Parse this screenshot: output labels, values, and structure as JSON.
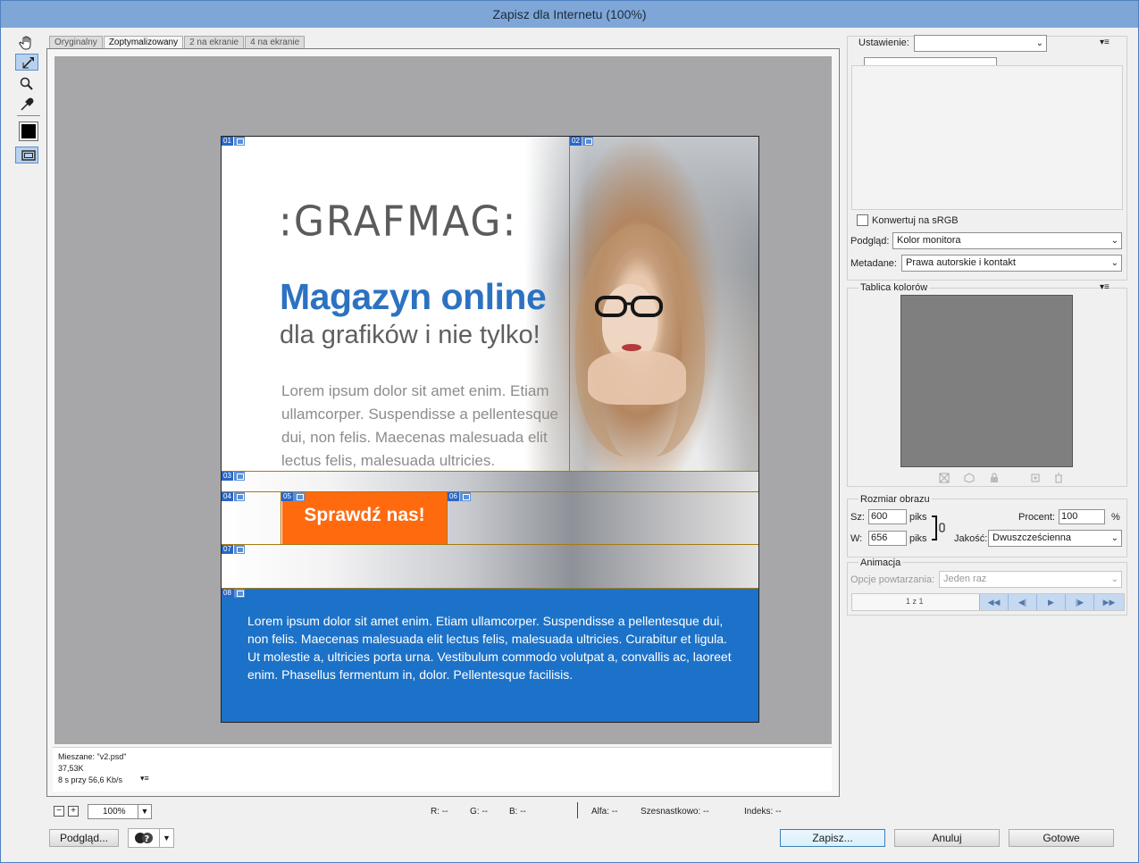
{
  "window": {
    "title": "Zapisz dla Internetu (100%)"
  },
  "tools": [
    {
      "name": "hand-tool"
    },
    {
      "name": "slice-select-tool"
    },
    {
      "name": "zoom-tool"
    },
    {
      "name": "eyedropper-tool"
    },
    {
      "name": "eyedropper-color"
    },
    {
      "name": "toggle-slices"
    }
  ],
  "tabs": [
    "Oryginalny",
    "Zoptymalizowany",
    "2 na ekranie",
    "4 na ekranie"
  ],
  "active_tab": 1,
  "design": {
    "logo": ":GRAFMAG:",
    "headline": "Magazyn online",
    "subhead": "dla grafików i nie tylko!",
    "lorem": "Lorem ipsum dolor sit amet enim. Etiam ullamcorper. Suspendisse a pellentesque dui, non felis. Maecenas malesuada elit lectus felis, malesuada ultricies.",
    "cta": "Sprawdź nas!",
    "footer_text": "Lorem ipsum dolor sit amet enim. Etiam ullamcorper. Suspendisse a pellentesque dui, non felis. Maecenas malesuada elit lectus felis, malesuada ultricies. Curabitur et ligula. Ut molestie a, ultricies porta urna. Vestibulum commodo volutpat a, convallis ac, laoreet enim. Phasellus fermentum in, dolor. Pellentesque facilisis.",
    "colors": {
      "blue": "#1c72c8",
      "orange": "#ff6a0f",
      "headline": "#2d72c1"
    },
    "slices": [
      "01",
      "02",
      "03",
      "04",
      "05",
      "06",
      "07",
      "08"
    ]
  },
  "info": {
    "mixed": "Mieszane: \"v2.psd\"",
    "size": "37,53K",
    "time": "8 s przy 56,6 Kb/s"
  },
  "zoom": {
    "minus": "−",
    "plus": "+",
    "value": "100%",
    "r": "R: --",
    "g": "G: --",
    "b": "B: --",
    "alpha": "Alfa: --",
    "hex": "Szesnastkowo: --",
    "index": "Indeks: --"
  },
  "buttons": {
    "preview": "Podgląd...",
    "save": "Zapisz...",
    "cancel": "Anuluj",
    "done": "Gotowe"
  },
  "panel": {
    "preset_label": "Ustawienie:",
    "preset_value": "",
    "format_value": "",
    "convert_srgb": "Konwertuj na sRGB",
    "preview_label": "Podgląd:",
    "preview_value": "Kolor monitora",
    "metadata_label": "Metadane:",
    "metadata_value": "Prawa autorskie i kontakt",
    "color_table_label": "Tablica kolorów",
    "image_size_label": "Rozmiar obrazu",
    "width_label": "Sz:",
    "width_value": "600",
    "height_label": "W:",
    "height_value": "656",
    "unit": "piks",
    "percent_label": "Procent:",
    "percent_value": "100",
    "percent_sign": "%",
    "quality_label": "Jakość:",
    "quality_value": "Dwuszcześcienna",
    "animation_label": "Animacja",
    "loop_label": "Opcje powtarzania:",
    "loop_value": "Jeden raz",
    "frame_counter": "1 z 1"
  }
}
